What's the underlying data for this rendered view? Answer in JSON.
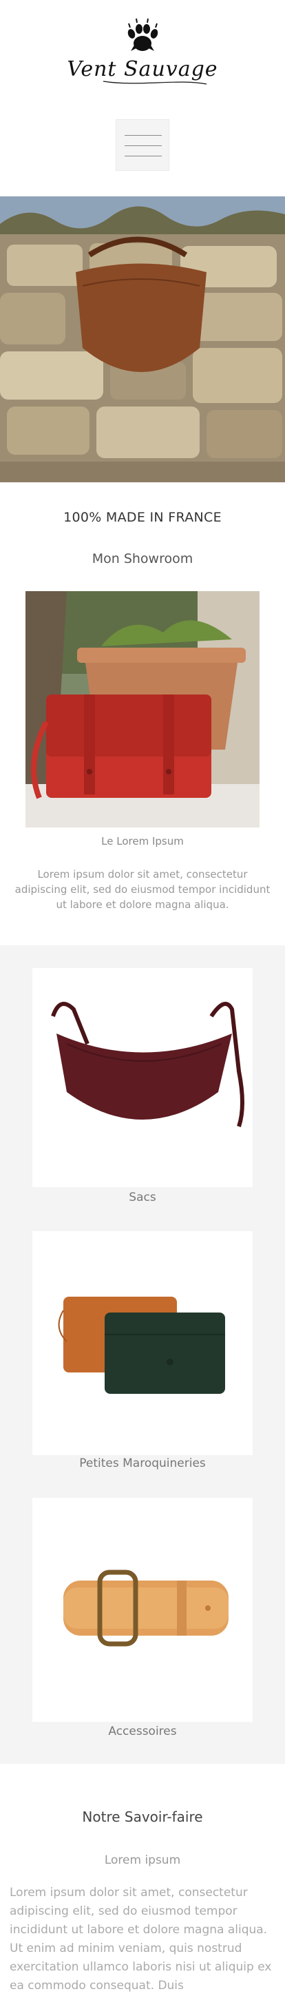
{
  "brand": {
    "name": "Vent Sauvage",
    "logo_icon": "paw-icon"
  },
  "header": {
    "menu_icon": "hamburger-icon"
  },
  "hero": {
    "image": "leather-bag-on-stone-wall"
  },
  "tagline": "100% MADE IN FRANCE",
  "showroom": {
    "title": "Mon Showroom",
    "caption": "Le Lorem Ipsum",
    "text": "Lorem ipsum dolor sit amet, consectetur adipiscing elit, sed do eiusmod tempor incididunt ut labore et dolore magna aliqua."
  },
  "categories": [
    {
      "label": "Sacs"
    },
    {
      "label": "Petites Maroquineries"
    },
    {
      "label": "Accessoires"
    }
  ],
  "savoir": {
    "title": "Notre Savoir-faire",
    "subtitle": "Lorem ipsum",
    "text": "Lorem ipsum dolor sit amet, consectetur adipiscing elit, sed do eiusmod tempor incididunt ut labore et dolore magna aliqua. Ut enim ad minim veniam, quis nostrud exercitation ullamco laboris nisi ut aliquip ex ea commodo consequat. Duis"
  },
  "colors": {
    "accent_red": "#c8322a",
    "leather_brown": "#8a4a26",
    "burgundy": "#5e1b22",
    "section_gray": "#f4f4f4"
  }
}
